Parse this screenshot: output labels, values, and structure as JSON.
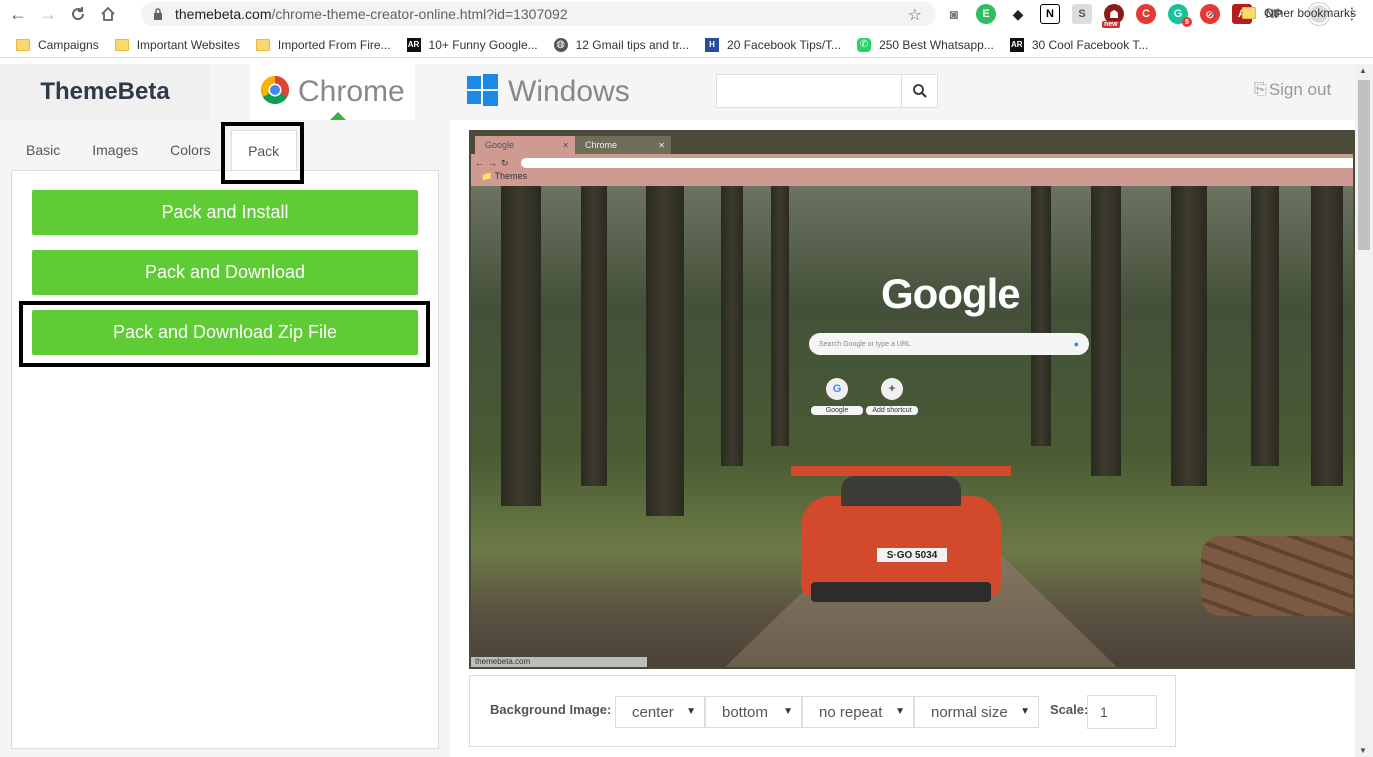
{
  "browser": {
    "url_host": "themebeta.com",
    "url_path": "/chrome-theme-creator-online.html?id=1307092",
    "ext_new_badge": "new",
    "ext_count_badge": "9",
    "ext_np": "NP"
  },
  "bookmarks": [
    {
      "label": "Campaigns",
      "icon": "folder-icon"
    },
    {
      "label": "Important Websites",
      "icon": "folder-icon"
    },
    {
      "label": "Imported From Fire...",
      "icon": "folder-icon"
    },
    {
      "label": "10+ Funny Google...",
      "icon": "ar-icon",
      "icon_text": "AR"
    },
    {
      "label": "12 Gmail tips and tr...",
      "icon": "globe-icon"
    },
    {
      "label": "20 Facebook Tips/T...",
      "icon": "h-icon",
      "icon_text": "H"
    },
    {
      "label": "250 Best Whatsapp...",
      "icon": "whatsapp-icon"
    },
    {
      "label": "30 Cool Facebook T...",
      "icon": "ar-icon",
      "icon_text": "AR"
    }
  ],
  "bookmarks_other": "Other bookmarks",
  "bookmarks_overflow": "»",
  "site": {
    "brand": "ThemeBeta",
    "tab_chrome": "Chrome",
    "tab_windows": "Windows",
    "search_placeholder": "",
    "signout": "Sign out"
  },
  "editor": {
    "tabs": [
      "Basic",
      "Images",
      "Colors",
      "Pack"
    ],
    "active_tab": "Pack",
    "buttons": {
      "pack_install": "Pack and Install",
      "pack_download": "Pack and Download",
      "pack_zip": "Pack and Download Zip File"
    }
  },
  "preview": {
    "tab1": "Google",
    "tab2": "Chrome",
    "bookmark": "Themes",
    "logo": "Google",
    "search_placeholder": "Search Google or type a URL",
    "shortcut1": "Google",
    "shortcut1_icon": "G",
    "shortcut2": "Add shortcut",
    "shortcut2_icon": "+",
    "plate": "S·GO 5034",
    "status": "themebeta.com"
  },
  "bg_options": {
    "label": "Background Image:",
    "position_x": "center",
    "position_y": "bottom",
    "repeat": "no repeat",
    "size": "normal size",
    "scale_label": "Scale:",
    "scale_value": "1"
  },
  "colors": {
    "accent_green": "#5fcb35",
    "preview_frame": "#cf9a92"
  }
}
